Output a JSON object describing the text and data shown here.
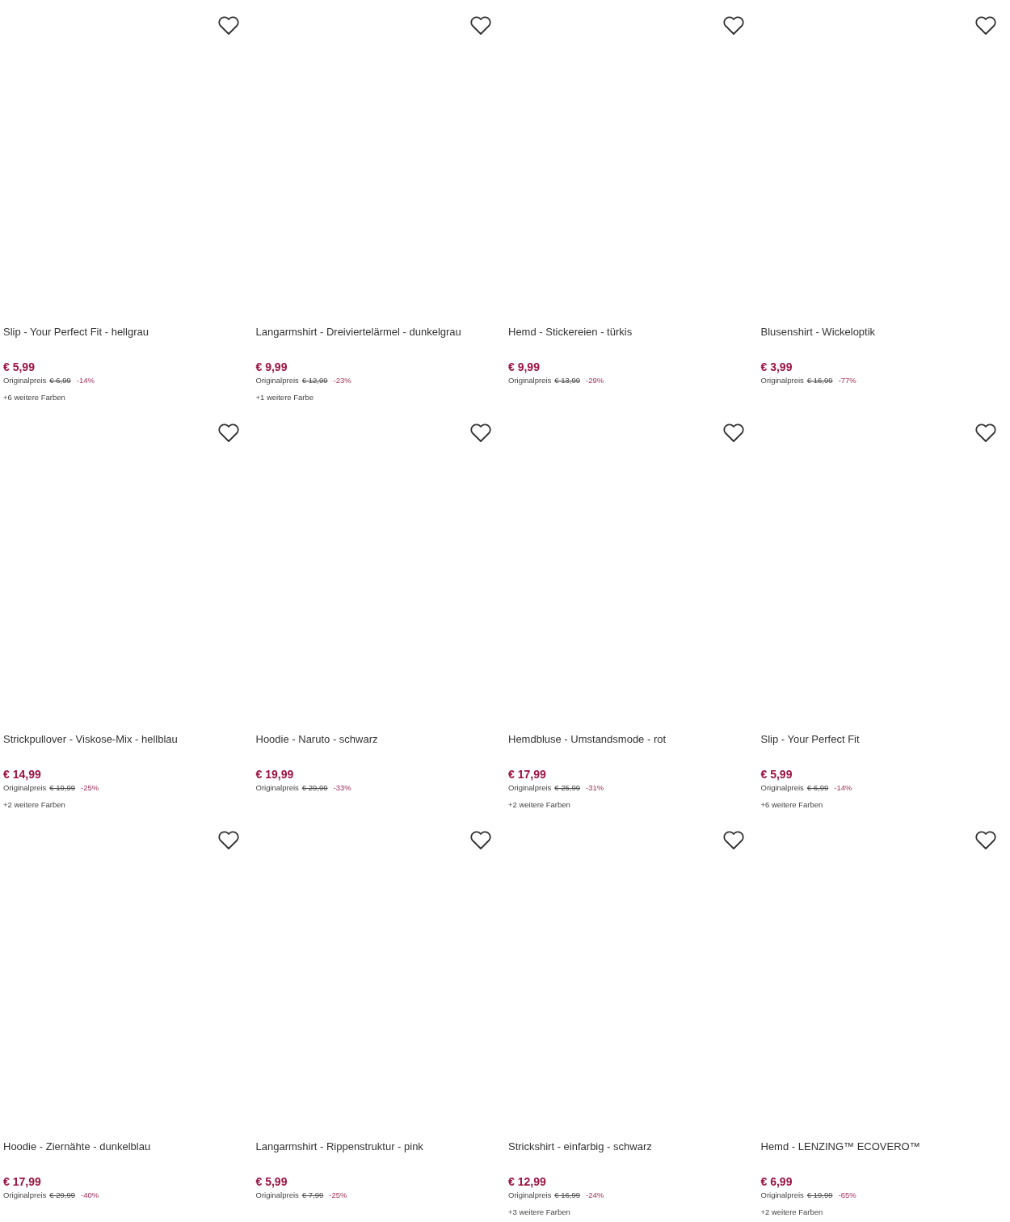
{
  "products": [
    {
      "title": "Slip - Your Perfect Fit - hellgrau",
      "price": "€ 5,99",
      "original_label": "Originalpreis",
      "original_price": "€ 6,99",
      "discount": "-14%",
      "more_colors": "+6 weitere Farben",
      "favorite": false
    },
    {
      "title": "Langarmshirt - Dreiviertelärmel - dunkelgrau",
      "price": "€ 9,99",
      "original_label": "Originalpreis",
      "original_price": "€ 12,99",
      "discount": "-23%",
      "more_colors": "+1 weitere Farbe",
      "favorite": false
    },
    {
      "title": "Hemd - Stickereien - türkis",
      "price": "€ 9,99",
      "original_label": "Originalpreis",
      "original_price": "€ 13,99",
      "discount": "-29%",
      "favorite": false
    },
    {
      "title": "Blusenshirt - Wickeloptik",
      "price": "€ 3,99",
      "original_label": "Originalpreis",
      "original_price": "€ 16,99",
      "discount": "-77%",
      "favorite": false
    },
    {
      "title": "Strickpullover - Viskose-Mix - hellblau",
      "price": "€ 14,99",
      "original_label": "Originalpreis",
      "original_price": "€ 19,99",
      "discount": "-25%",
      "more_colors": "+2 weitere Farben",
      "favorite": false
    },
    {
      "title": "Hoodie - Naruto - schwarz",
      "price": "€ 19,99",
      "original_label": "Originalpreis",
      "original_price": "€ 29,99",
      "discount": "-33%",
      "favorite": false
    },
    {
      "title": "Hemdbluse - Umstandsmode - rot",
      "price": "€ 17,99",
      "original_label": "Originalpreis",
      "original_price": "€ 25,99",
      "discount": "-31%",
      "more_colors": "+2 weitere Farben",
      "favorite": false
    },
    {
      "title": "Slip - Your Perfect Fit",
      "price": "€ 5,99",
      "original_label": "Originalpreis",
      "original_price": "€ 6,99",
      "discount": "-14%",
      "more_colors": "+6 weitere Farben",
      "favorite": false
    },
    {
      "title": "Hoodie - Ziernähte - dunkelblau",
      "price": "€ 17,99",
      "original_label": "Originalpreis",
      "original_price": "€ 29,99",
      "discount": "-40%",
      "favorite": false
    },
    {
      "title": "Langarmshirt - Rippenstruktur - pink",
      "price": "€ 5,99",
      "original_label": "Originalpreis",
      "original_price": "€ 7,99",
      "discount": "-25%",
      "favorite": false
    },
    {
      "title": "Strickshirt - einfarbig - schwarz",
      "price": "€ 12,99",
      "original_label": "Originalpreis",
      "original_price": "€ 16,99",
      "discount": "-24%",
      "more_colors": "+3 weitere Farben",
      "favorite": false
    },
    {
      "title": "Hemd - LENZING™ ECOVERO™",
      "price": "€ 6,99",
      "original_label": "Originalpreis",
      "original_price": "€ 19,99",
      "discount": "-65%",
      "more_colors": "+2 weitere Farben",
      "favorite": false
    }
  ]
}
